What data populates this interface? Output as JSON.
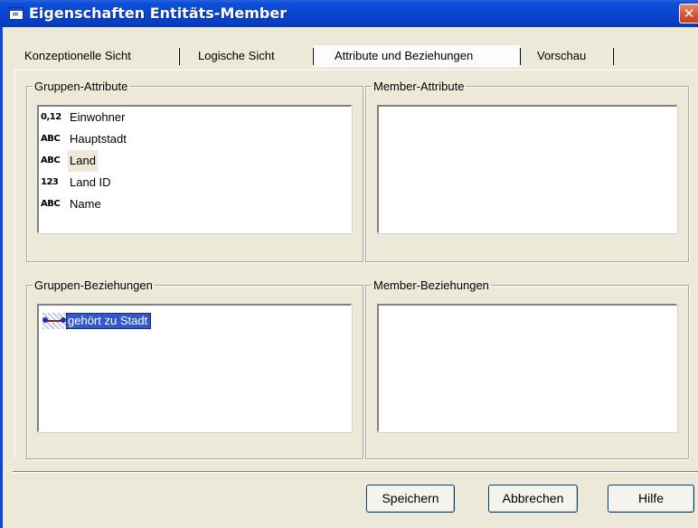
{
  "window": {
    "title": "Eigenschaften Entitäts-Member",
    "close_glyph": "✕"
  },
  "tabs": [
    {
      "label": "Konzeptionelle Sicht",
      "active": false
    },
    {
      "label": "Logische Sicht",
      "active": false
    },
    {
      "label": "Attribute und Beziehungen",
      "active": true
    },
    {
      "label": "Vorschau",
      "active": false
    }
  ],
  "groups": {
    "gruppen_attribute": {
      "legend": "Gruppen-Attribute",
      "items": [
        {
          "type_icon": "0,12",
          "type": "decimal-type-icon",
          "label": "Einwohner"
        },
        {
          "type_icon": "ABC",
          "type": "text-type-icon",
          "label": "Hauptstadt"
        },
        {
          "type_icon": "ABC",
          "type": "text-type-icon",
          "label": "Land"
        },
        {
          "type_icon": "123",
          "type": "integer-type-icon",
          "label": "Land ID"
        },
        {
          "type_icon": "ABC",
          "type": "text-type-icon",
          "label": "Name"
        }
      ]
    },
    "member_attribute": {
      "legend": "Member-Attribute",
      "items": []
    },
    "gruppen_beziehungen": {
      "legend": "Gruppen-Beziehungen",
      "items": [
        {
          "icon": "relationship-icon",
          "label": "gehört zu Stadt"
        }
      ]
    },
    "member_beziehungen": {
      "legend": "Member-Beziehungen",
      "items": []
    }
  },
  "buttons": {
    "save": "Speichern",
    "cancel": "Abbrechen",
    "help": "Hilfe"
  },
  "colors": {
    "titlebar": "#0a46d0",
    "dialog_bg": "#ece9d8",
    "selection": "#3159c9",
    "close_button": "#d5532e"
  }
}
